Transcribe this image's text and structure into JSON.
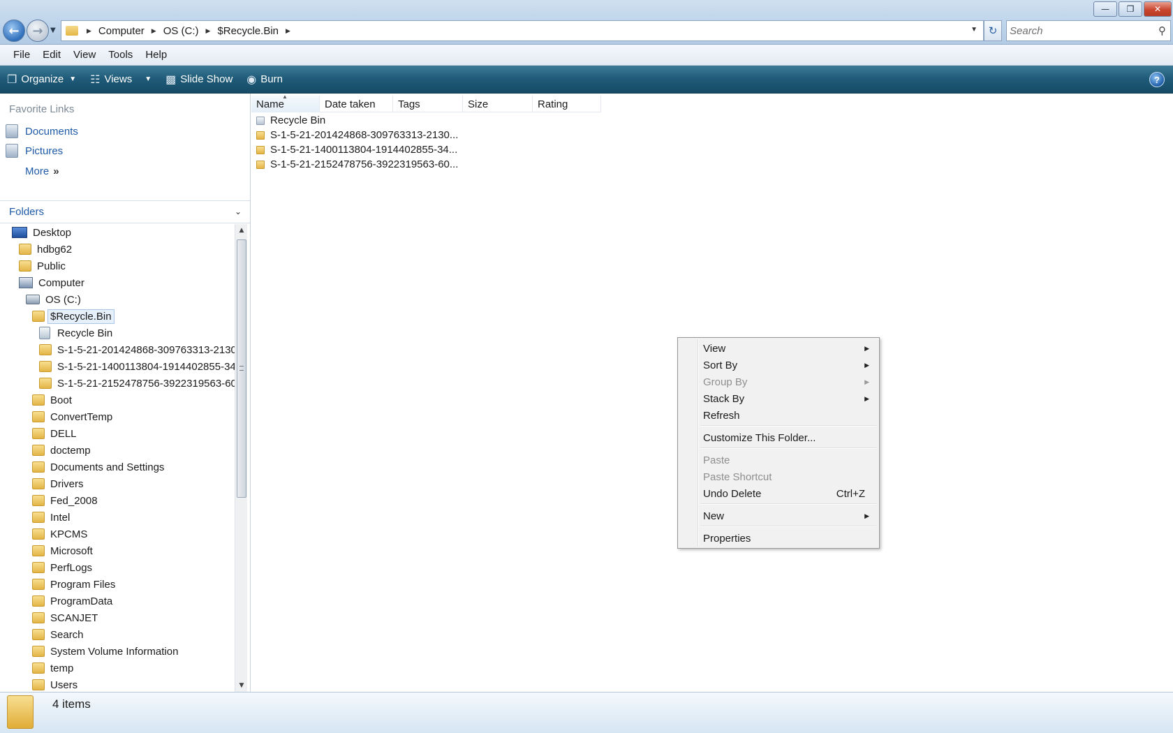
{
  "window": {
    "controls": [
      "minimize",
      "maximize",
      "close"
    ]
  },
  "address": {
    "crumbs": [
      "Computer",
      "OS (C:)",
      "$Recycle.Bin"
    ]
  },
  "search": {
    "placeholder": "Search"
  },
  "menubar": [
    "File",
    "Edit",
    "View",
    "Tools",
    "Help"
  ],
  "commandbar": {
    "organize": "Organize",
    "views": "Views",
    "slideshow": "Slide Show",
    "burn": "Burn"
  },
  "favorites": {
    "title": "Favorite Links",
    "items": [
      "Documents",
      "Pictures"
    ],
    "more": "More"
  },
  "folders": {
    "title": "Folders",
    "tree": [
      {
        "label": "Desktop",
        "icon": "desktop-icon",
        "indent": 0
      },
      {
        "label": "hdbg62",
        "icon": "folder-icon",
        "indent": 1
      },
      {
        "label": "Public",
        "icon": "folder-icon",
        "indent": 1
      },
      {
        "label": "Computer",
        "icon": "computer-icon",
        "indent": 1
      },
      {
        "label": "OS (C:)",
        "icon": "drive-icon",
        "indent": 2
      },
      {
        "label": "$Recycle.Bin",
        "icon": "folder-icon",
        "indent": 3,
        "selected": true
      },
      {
        "label": "Recycle Bin",
        "icon": "recycle-bin-icon",
        "indent": 4
      },
      {
        "label": "S-1-5-21-201424868-309763313-2130",
        "icon": "folder-icon",
        "indent": 4
      },
      {
        "label": "S-1-5-21-1400113804-1914402855-34",
        "icon": "folder-icon",
        "indent": 4
      },
      {
        "label": "S-1-5-21-2152478756-3922319563-60",
        "icon": "folder-icon",
        "indent": 4
      },
      {
        "label": "Boot",
        "icon": "folder-icon",
        "indent": 3
      },
      {
        "label": "ConvertTemp",
        "icon": "folder-icon",
        "indent": 3
      },
      {
        "label": "DELL",
        "icon": "folder-icon",
        "indent": 3
      },
      {
        "label": "doctemp",
        "icon": "folder-icon",
        "indent": 3
      },
      {
        "label": "Documents and Settings",
        "icon": "folder-icon",
        "indent": 3
      },
      {
        "label": "Drivers",
        "icon": "folder-icon",
        "indent": 3
      },
      {
        "label": "Fed_2008",
        "icon": "folder-icon",
        "indent": 3
      },
      {
        "label": "Intel",
        "icon": "folder-icon",
        "indent": 3
      },
      {
        "label": "KPCMS",
        "icon": "folder-icon",
        "indent": 3
      },
      {
        "label": "Microsoft",
        "icon": "folder-icon",
        "indent": 3
      },
      {
        "label": "PerfLogs",
        "icon": "folder-icon",
        "indent": 3
      },
      {
        "label": "Program Files",
        "icon": "folder-icon",
        "indent": 3
      },
      {
        "label": "ProgramData",
        "icon": "folder-icon",
        "indent": 3
      },
      {
        "label": "SCANJET",
        "icon": "folder-icon",
        "indent": 3
      },
      {
        "label": "Search",
        "icon": "folder-icon",
        "indent": 3
      },
      {
        "label": "System Volume Information",
        "icon": "folder-icon",
        "indent": 3
      },
      {
        "label": "temp",
        "icon": "folder-icon",
        "indent": 3
      },
      {
        "label": "Users",
        "icon": "folder-icon",
        "indent": 3
      }
    ]
  },
  "columns": [
    "Name",
    "Date taken",
    "Tags",
    "Size",
    "Rating"
  ],
  "files": [
    {
      "name": "Recycle Bin",
      "icon": "recycle-bin-icon"
    },
    {
      "name": "S-1-5-21-201424868-309763313-2130...",
      "icon": "folder-icon"
    },
    {
      "name": "S-1-5-21-1400113804-1914402855-34...",
      "icon": "folder-icon"
    },
    {
      "name": "S-1-5-21-2152478756-3922319563-60...",
      "icon": "folder-icon"
    }
  ],
  "context_menu": [
    {
      "label": "View",
      "submenu": true,
      "disabled": false
    },
    {
      "label": "Sort By",
      "submenu": true,
      "disabled": false
    },
    {
      "label": "Group By",
      "submenu": true,
      "disabled": true
    },
    {
      "label": "Stack By",
      "submenu": true,
      "disabled": false
    },
    {
      "label": "Refresh",
      "submenu": false,
      "disabled": false
    },
    {
      "separator": true
    },
    {
      "label": "Customize This Folder...",
      "submenu": false,
      "disabled": false
    },
    {
      "separator": true
    },
    {
      "label": "Paste",
      "submenu": false,
      "disabled": true
    },
    {
      "label": "Paste Shortcut",
      "submenu": false,
      "disabled": true
    },
    {
      "label": "Undo Delete",
      "shortcut": "Ctrl+Z",
      "submenu": false,
      "disabled": false
    },
    {
      "separator": true
    },
    {
      "label": "New",
      "submenu": true,
      "disabled": false
    },
    {
      "separator": true
    },
    {
      "label": "Properties",
      "submenu": false,
      "disabled": false
    }
  ],
  "status": {
    "text": "4 items"
  }
}
